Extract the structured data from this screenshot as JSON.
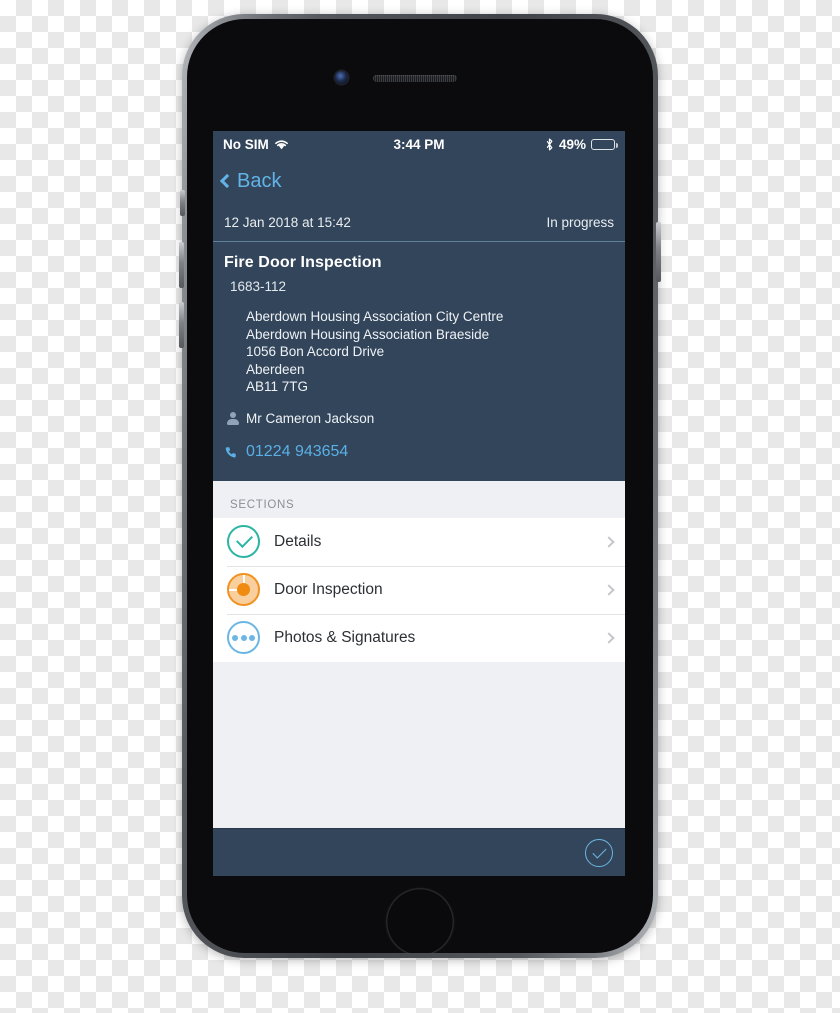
{
  "status_bar": {
    "carrier": "No SIM",
    "wifi_icon": "wifi-icon",
    "time": "3:44 PM",
    "bluetooth_icon": "bluetooth-icon",
    "battery_percent": "49%",
    "battery_level": 49
  },
  "nav": {
    "back_label": "Back",
    "back_icon": "chevron-left-icon"
  },
  "meta": {
    "datetime": "12 Jan 2018 at 15:42",
    "status": "In progress"
  },
  "job": {
    "title": "Fire Door Inspection",
    "reference": "1683-112",
    "location_icon": "map-pin-icon",
    "address_lines": [
      "Aberdown Housing Association City Centre",
      "Aberdown Housing Association Braeside",
      "1056 Bon Accord Drive",
      "Aberdeen",
      "AB11 7TG"
    ],
    "contact_icon": "person-icon",
    "contact_name": "Mr Cameron Jackson",
    "phone_icon": "phone-icon",
    "phone_number": "01224 943654"
  },
  "sections": {
    "header": "SECTIONS",
    "items": [
      {
        "label": "Details",
        "state": "complete",
        "icon": "check-circle-icon",
        "chevron": "chevron-right-icon"
      },
      {
        "label": "Door Inspection",
        "state": "in-progress",
        "icon": "progress-pie-icon",
        "chevron": "chevron-right-icon"
      },
      {
        "label": "Photos & Signatures",
        "state": "not-started",
        "icon": "ellipsis-circle-icon",
        "chevron": "chevron-right-icon"
      }
    ]
  },
  "toolbar": {
    "submit_icon": "check-circle-icon"
  },
  "colors": {
    "panel_dark": "#33455a",
    "accent_blue": "#59b0e6",
    "complete_green": "#2bb5a2",
    "in_progress_orange": "#ef9220",
    "not_started_blue": "#6cb6e3",
    "list_background": "#eff0f4"
  }
}
